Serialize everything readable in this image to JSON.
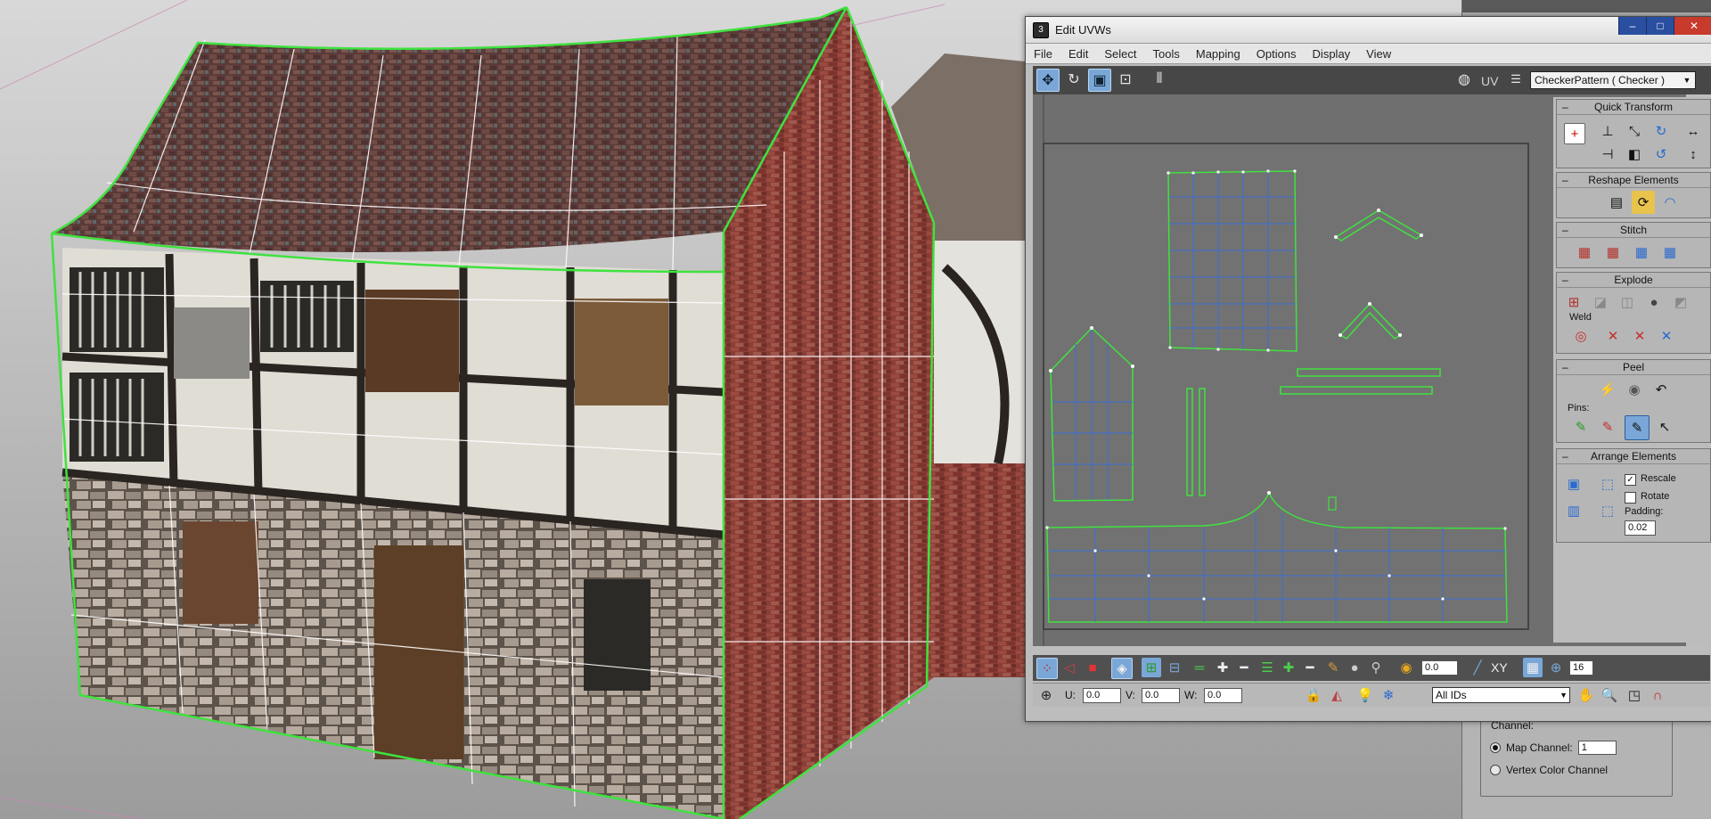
{
  "window": {
    "title": "Edit UVWs",
    "minimize": "–",
    "maximize": "□",
    "close": "✕"
  },
  "menu": [
    "File",
    "Edit",
    "Select",
    "Tools",
    "Mapping",
    "Options",
    "Display",
    "View"
  ],
  "toolbar": {
    "uv_label": "UV",
    "checker_select": "CheckerPattern  ( Checker )",
    "icons": [
      "move-icon",
      "rotate-icon",
      "scale-icon",
      "freeform-icon",
      "mirror-icon",
      "checker-globe-icon",
      "list-icon"
    ]
  },
  "rollouts": {
    "quick_transform": "Quick Transform",
    "reshape_elements": "Reshape Elements",
    "stitch": "Stitch",
    "explode": "Explode",
    "weld": "Weld",
    "peel": "Peel",
    "pins": "Pins:",
    "arrange_elements": "Arrange Elements",
    "rescale": "Rescale",
    "rotate": "Rotate",
    "padding_label": "Padding:",
    "padding_value": "0.02",
    "rescale_checked": true,
    "rotate_checked": false,
    "collapse_symbol": "–"
  },
  "bottom_bar": {
    "soft_value": "0.0",
    "xy_label": "XY",
    "grid_value": "16",
    "u_label": "U:",
    "u_value": "0.0",
    "v_label": "V:",
    "v_value": "0.0",
    "w_label": "W:",
    "w_value": "0.0",
    "ids_select": "All IDs"
  },
  "command_panel": {
    "channel_label": "Channel:",
    "map_channel_label": "Map Channel:",
    "map_channel_value": "1",
    "vertex_color_label": "Vertex Color Channel",
    "map_channel_selected": true
  },
  "colors": {
    "selection_green": "#3fe23f",
    "uv_blue": "#3a6fd8",
    "editor_bg": "#6f6f6f",
    "active_blue": "#7aa7d7"
  }
}
